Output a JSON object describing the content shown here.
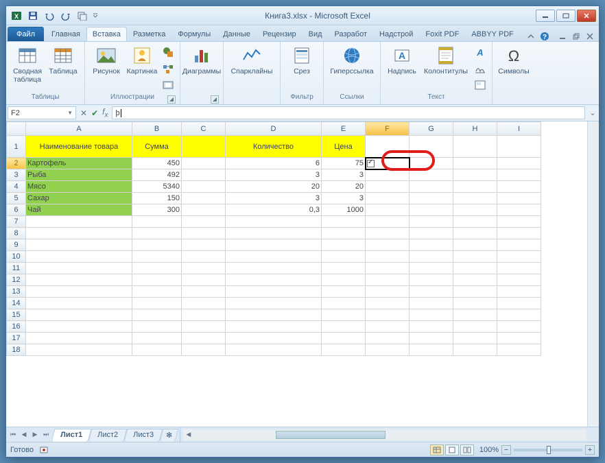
{
  "title": "Книга3.xlsx - Microsoft Excel",
  "tabs": {
    "file": "Файл",
    "home": "Главная",
    "insert": "Вставка",
    "layout": "Разметка",
    "formulas": "Формулы",
    "data": "Данные",
    "review": "Рецензир",
    "view": "Вид",
    "dev": "Разработ",
    "addins": "Надстрой",
    "foxit": "Foxit PDF",
    "abbyy": "ABBYY PDF"
  },
  "ribbon": {
    "groups": {
      "tables": "Таблицы",
      "illustrations": "Иллюстрации",
      "filter": "Фильтр",
      "links": "Ссылки",
      "text": "Текст",
      "symbols_label": ""
    },
    "pivot": "Сводная таблица",
    "table": "Таблица",
    "picture": "Рисунок",
    "clipart": "Картинка",
    "charts": "Диаграммы",
    "sparklines": "Спарклайны",
    "slicer": "Срез",
    "hyperlink": "Гиперссылка",
    "textbox": "Надпись",
    "headerfooter": "Колонтитулы",
    "symbols": "Символы"
  },
  "namebox": "F2",
  "formula": "þ",
  "columns": [
    "A",
    "B",
    "C",
    "D",
    "E",
    "F",
    "G",
    "H",
    "I"
  ],
  "headers": {
    "a": "Наименование товара",
    "b": "Сумма",
    "d": "Количество",
    "e": "Цена"
  },
  "rows": [
    {
      "name": "Картофель",
      "sum": "450",
      "qty": "6",
      "price": "75"
    },
    {
      "name": "Рыба",
      "sum": "492",
      "qty": "3",
      "price": "3"
    },
    {
      "name": "Мясо",
      "sum": "5340",
      "qty": "20",
      "price": "20"
    },
    {
      "name": "Сахар",
      "sum": "150",
      "qty": "3",
      "price": "3"
    },
    {
      "name": "Чай",
      "sum": "300",
      "qty": "0,3",
      "price": "1000"
    }
  ],
  "sheets": [
    "Лист1",
    "Лист2",
    "Лист3"
  ],
  "status": "Готово",
  "zoom": "100%",
  "chart_data": {
    "type": "table",
    "columns": [
      "Наименование товара",
      "Сумма",
      "Количество",
      "Цена"
    ],
    "rows": [
      [
        "Картофель",
        450,
        6,
        75
      ],
      [
        "Рыба",
        492,
        3,
        3
      ],
      [
        "Мясо",
        5340,
        20,
        20
      ],
      [
        "Сахар",
        150,
        3,
        3
      ],
      [
        "Чай",
        300,
        0.3,
        1000
      ]
    ]
  }
}
